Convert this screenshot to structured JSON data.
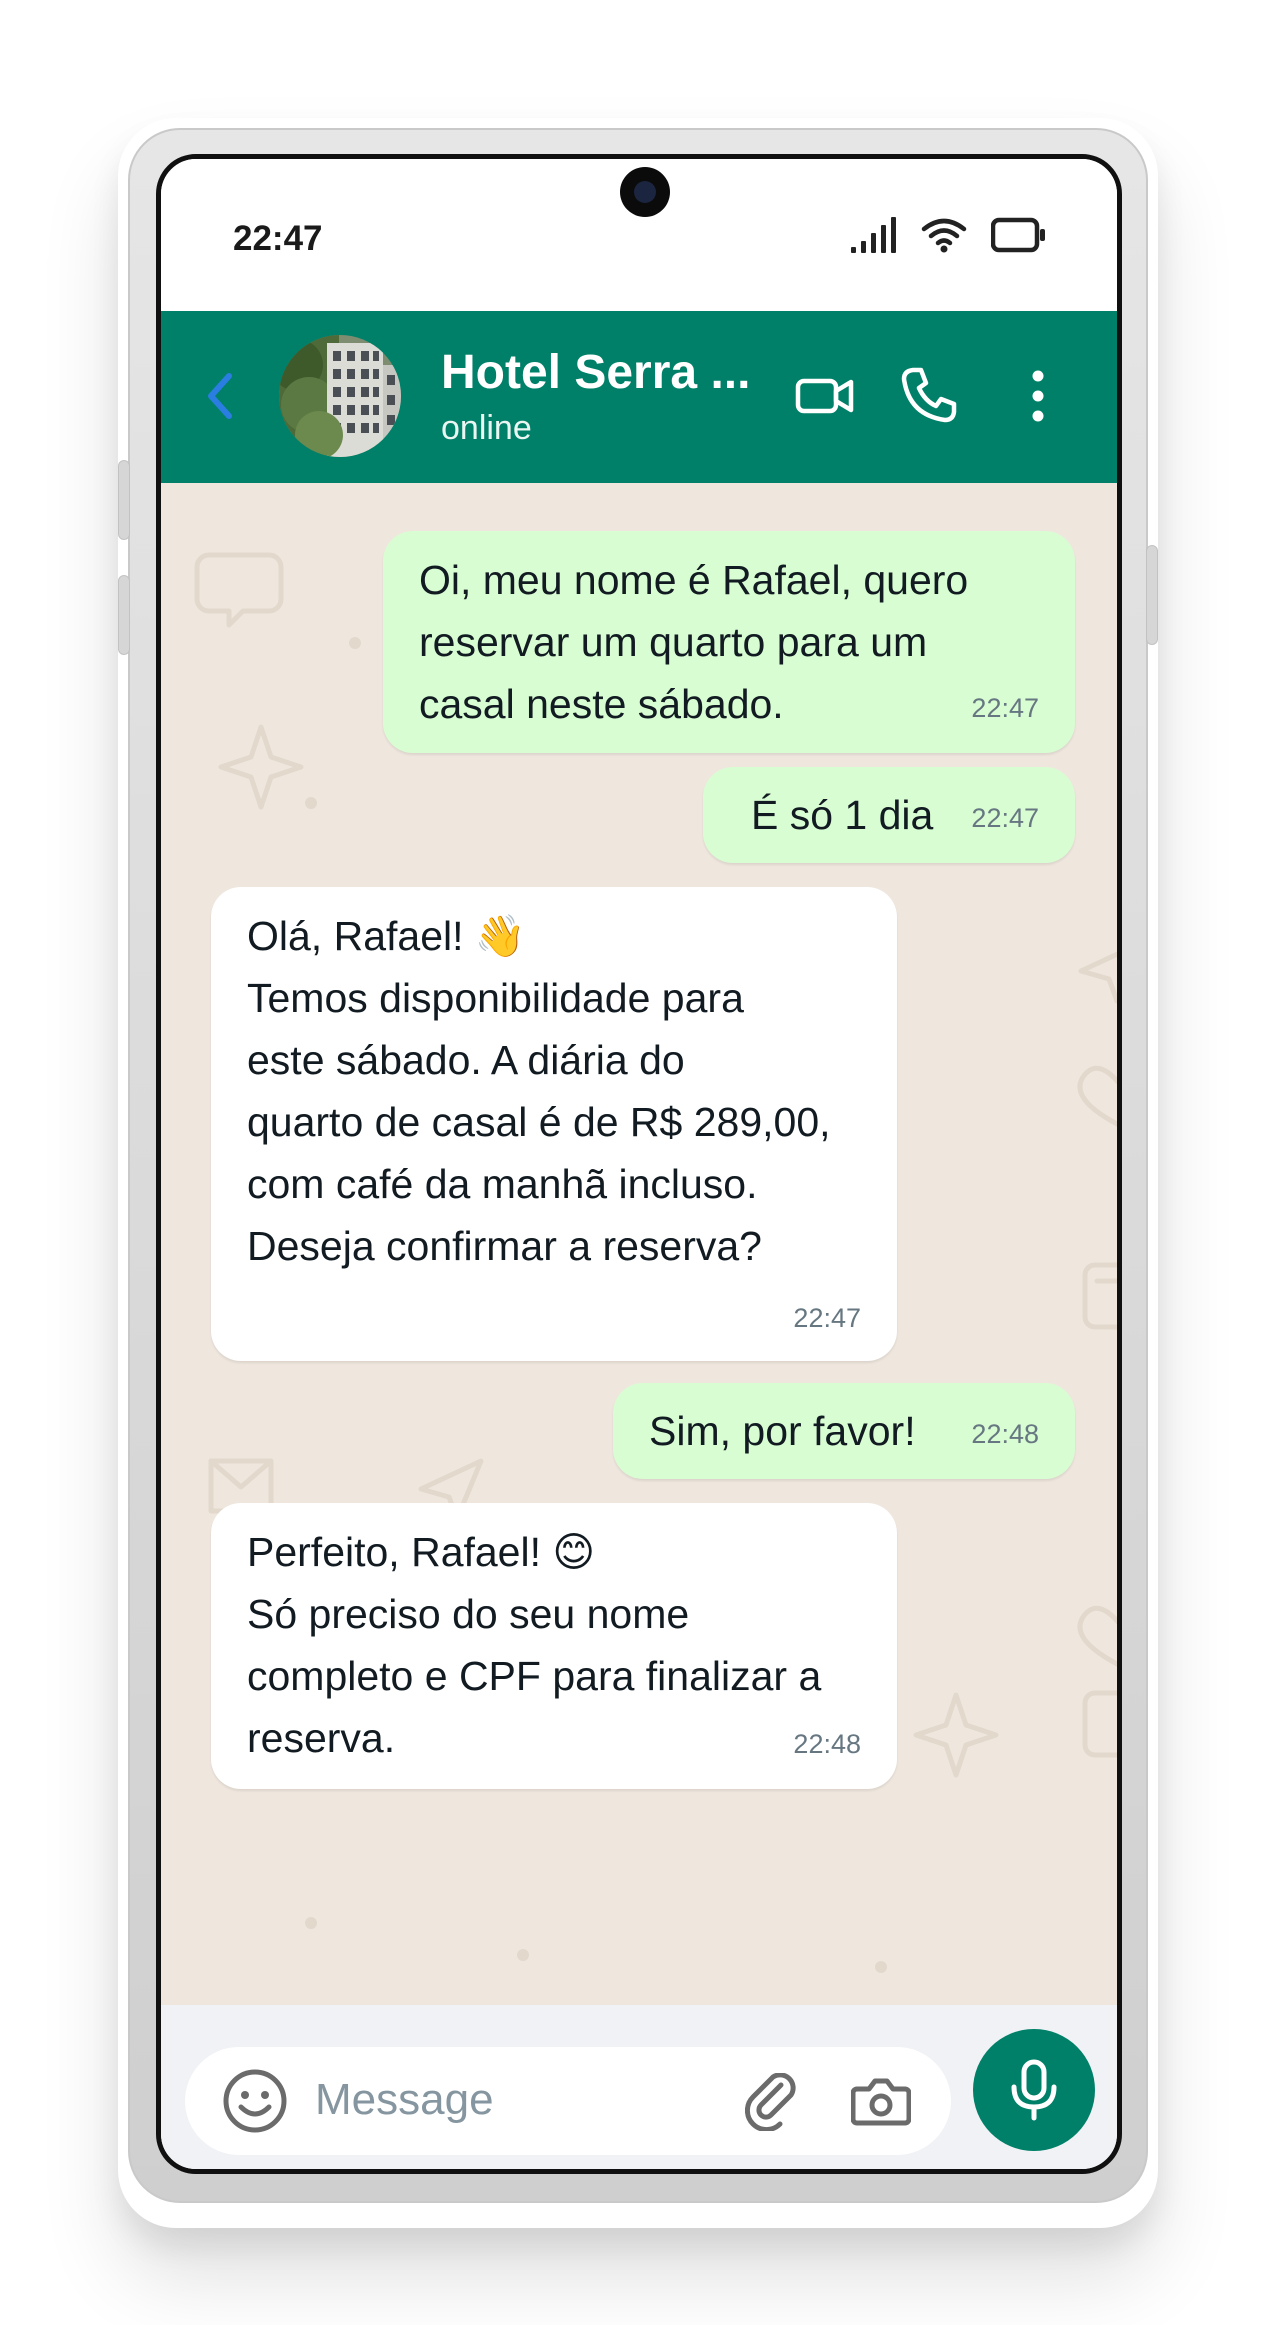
{
  "status_bar": {
    "time": "22:47"
  },
  "header": {
    "contact_name": "Hotel Serra ...",
    "contact_status": "online"
  },
  "messages": [
    {
      "direction": "outgoing",
      "text": "Oi, meu nome é Rafael, quero\nreservar um quarto para um\ncasal neste sábado.",
      "time": "22:47"
    },
    {
      "direction": "outgoing",
      "text": "É só 1 dia",
      "time": "22:47"
    },
    {
      "direction": "incoming",
      "text": "Olá, Rafael! 👋\nTemos disponibilidade para\neste sábado. A diária do\nquarto de casal é de R$ 289,00,\ncom café da manhã incluso.\nDeseja confirmar a reserva?",
      "time": "22:47"
    },
    {
      "direction": "outgoing",
      "text": "Sim, por favor!",
      "time": "22:48"
    },
    {
      "direction": "incoming",
      "text": "Perfeito, Rafael! 😊\nSó preciso do seu nome\ncompleto e CPF para finalizar a\nreserva.",
      "time": "22:48"
    }
  ],
  "input": {
    "placeholder": "Message"
  },
  "colors": {
    "header": "#008069",
    "outgoing_bubble": "#d9fdd3",
    "incoming_bubble": "#ffffff",
    "chat_background": "#efe7de",
    "back_arrow": "#2a7de1"
  },
  "icons": {
    "back": "chevron-left-icon",
    "video": "video-camera-icon",
    "call": "phone-icon",
    "menu": "more-vertical-icon",
    "emoji": "smiley-icon",
    "attach": "paperclip-icon",
    "camera": "camera-icon",
    "mic": "microphone-icon"
  }
}
